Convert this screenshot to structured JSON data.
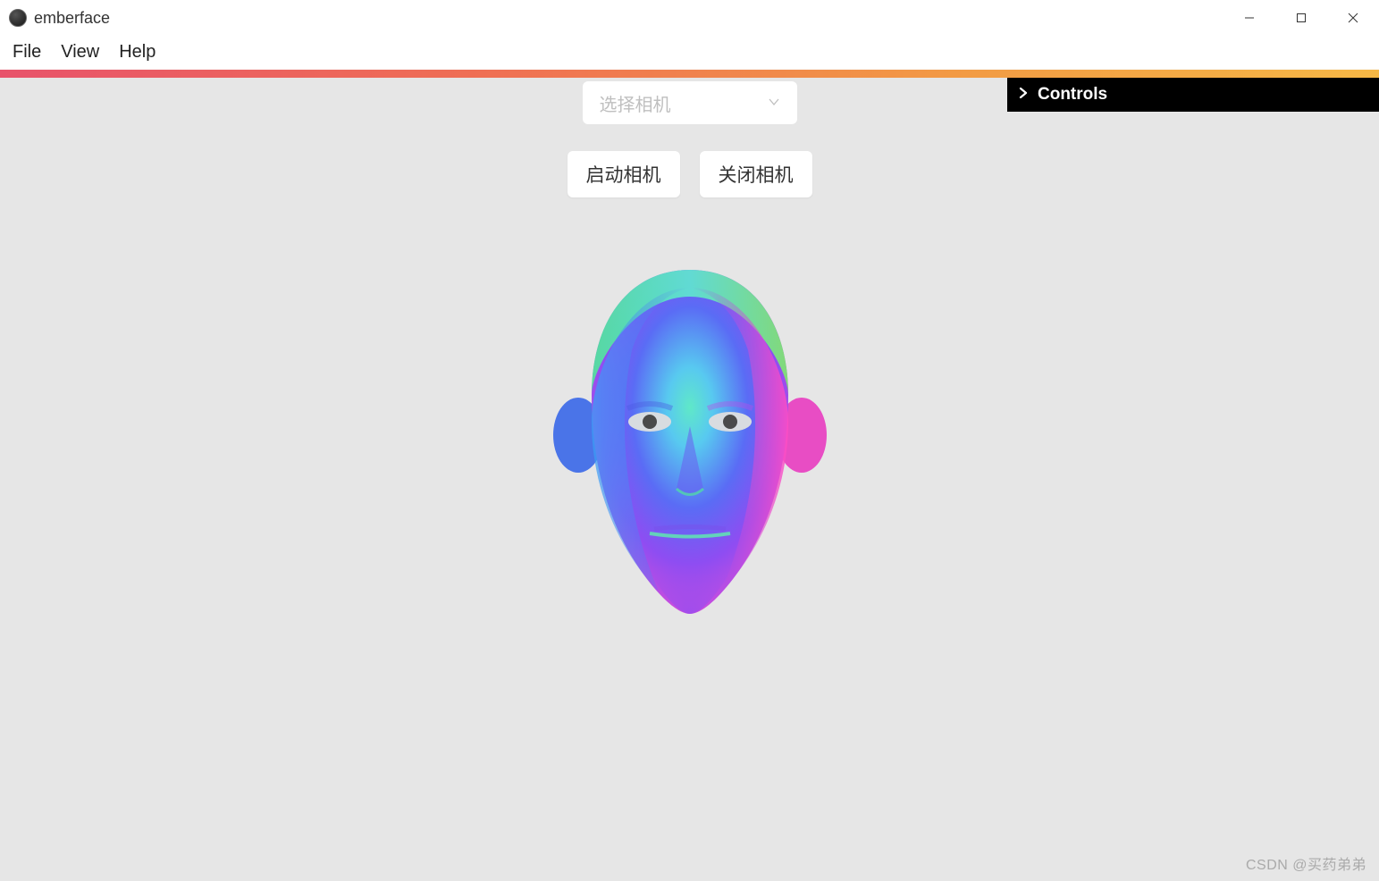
{
  "window": {
    "title": "emberface"
  },
  "menu": {
    "file": "File",
    "view": "View",
    "help": "Help"
  },
  "camera": {
    "placeholder": "选择相机",
    "start_label": "启动相机",
    "stop_label": "关闭相机"
  },
  "panel": {
    "controls_label": "Controls"
  },
  "watermark": "CSDN @买药弟弟"
}
